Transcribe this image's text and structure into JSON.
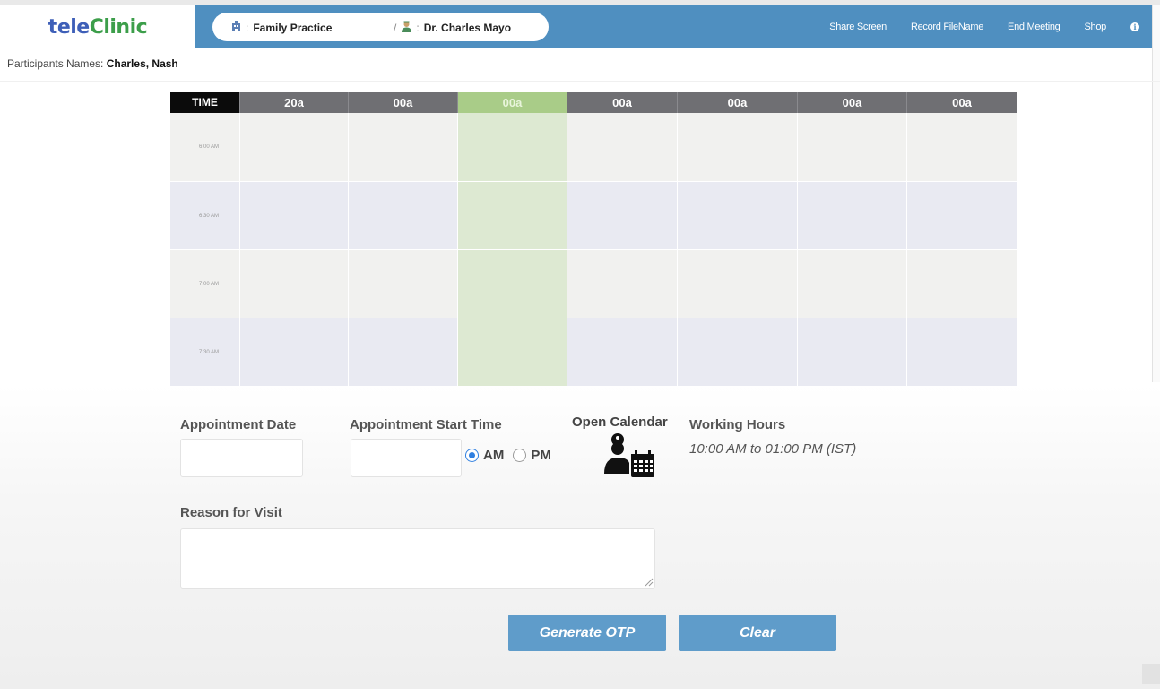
{
  "header": {
    "logo_tele": "tele",
    "logo_clinic": "Clinic",
    "practice_label": "Family Practice",
    "doctor_label": "Dr. Charles Mayo",
    "separator": ":",
    "slash": "/",
    "nav": [
      "Share Screen",
      "Record FileName",
      "End Meeting",
      "Shop"
    ],
    "info_glyph": "i"
  },
  "participants": {
    "label": "Participants Names:",
    "names": "Charles, Nash"
  },
  "calendar": {
    "time_header": "TIME",
    "days": [
      "20a",
      "00a",
      "00a",
      "00a",
      "00a",
      "00a",
      "00a"
    ],
    "today_index": 2,
    "times": [
      "6:00 AM",
      "6:30 AM",
      "7:00 AM",
      "7:30 AM"
    ]
  },
  "form": {
    "appointment_date_label": "Appointment Date",
    "appointment_date_value": "",
    "start_time_label": "Appointment Start Time",
    "start_time_value": "",
    "am_label": "AM",
    "pm_label": "PM",
    "selected_period": "AM",
    "open_calendar_label": "Open Calendar",
    "working_hours_label": "Working Hours",
    "working_hours_value": "10:00 AM to 01:00 PM (IST)",
    "reason_label": "Reason for Visit",
    "reason_value": "",
    "generate_button": "Generate OTP",
    "clear_button": "Clear"
  },
  "icons": {
    "practice": "hospital-icon",
    "doctor": "doctor-icon",
    "calendar": "doctor-calendar-icon",
    "info": "info-icon"
  },
  "colors": {
    "navbar": "#4f8fc0",
    "button": "#5f9cca",
    "logo_tele": "#3e5fb8",
    "logo_clinic": "#3c9e4a",
    "today_header": "#a9cc88"
  }
}
